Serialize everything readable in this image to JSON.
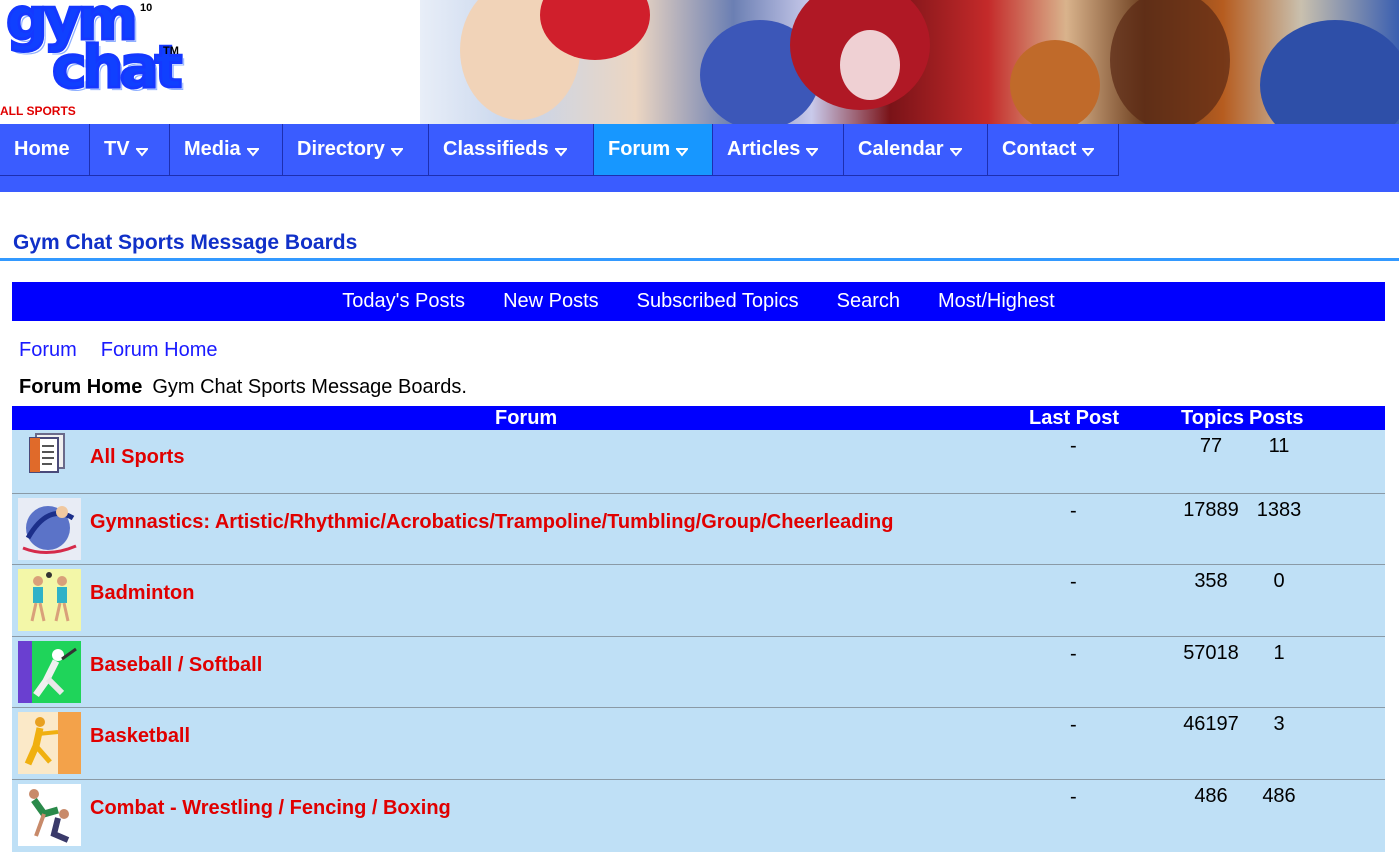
{
  "logo": {
    "line1": "gym",
    "line2": "chat",
    "version": "10",
    "tm": "TM",
    "tagline": "ALL SPORTS"
  },
  "nav": [
    {
      "label": "Home",
      "dropdown": false,
      "active": false
    },
    {
      "label": "TV",
      "dropdown": true,
      "active": false
    },
    {
      "label": "Media",
      "dropdown": true,
      "active": false
    },
    {
      "label": "Directory",
      "dropdown": true,
      "active": false
    },
    {
      "label": "Classifieds",
      "dropdown": true,
      "active": false
    },
    {
      "label": "Forum",
      "dropdown": true,
      "active": true
    },
    {
      "label": "Articles",
      "dropdown": true,
      "active": false
    },
    {
      "label": "Calendar",
      "dropdown": true,
      "active": false
    },
    {
      "label": "Contact",
      "dropdown": true,
      "active": false
    }
  ],
  "page_title": "Gym Chat Sports Message Boards",
  "subnav": [
    "Today's Posts",
    "New Posts",
    "Subscribed Topics",
    "Search",
    "Most/Highest"
  ],
  "breadcrumb": [
    "Forum",
    "Forum Home"
  ],
  "forum_home": {
    "label": "Forum Home",
    "description": "Gym Chat Sports Message Boards."
  },
  "table": {
    "headers": {
      "forum": "Forum",
      "last_post": "Last Post",
      "topics": "Topics",
      "posts": "Posts"
    },
    "rows": [
      {
        "name": "All Sports",
        "icon": "document-icon",
        "last_post": "-",
        "topics": "77",
        "posts": "11"
      },
      {
        "name": "Gymnastics: Artistic/Rhythmic/Acrobatics/Trampoline/Tumbling/Group/Cheerleading",
        "icon": "gymnastics-icon",
        "last_post": "-",
        "topics": "17889",
        "posts": "1383"
      },
      {
        "name": "Badminton",
        "icon": "badminton-icon",
        "last_post": "-",
        "topics": "358",
        "posts": "0"
      },
      {
        "name": "Baseball / Softball",
        "icon": "baseball-icon",
        "last_post": "-",
        "topics": "57018",
        "posts": "1"
      },
      {
        "name": "Basketball",
        "icon": "basketball-icon",
        "last_post": "-",
        "topics": "46197",
        "posts": "3"
      },
      {
        "name": "Combat - Wrestling / Fencing / Boxing",
        "icon": "wrestling-icon",
        "last_post": "-",
        "topics": "486",
        "posts": "486"
      }
    ]
  },
  "colors": {
    "nav_bg": "#3a5cff",
    "nav_active": "#1797ff",
    "subnav_bg": "#0000ff",
    "row_bg": "#bfe0f6",
    "forum_link": "#e00000",
    "title": "#1030c8"
  }
}
